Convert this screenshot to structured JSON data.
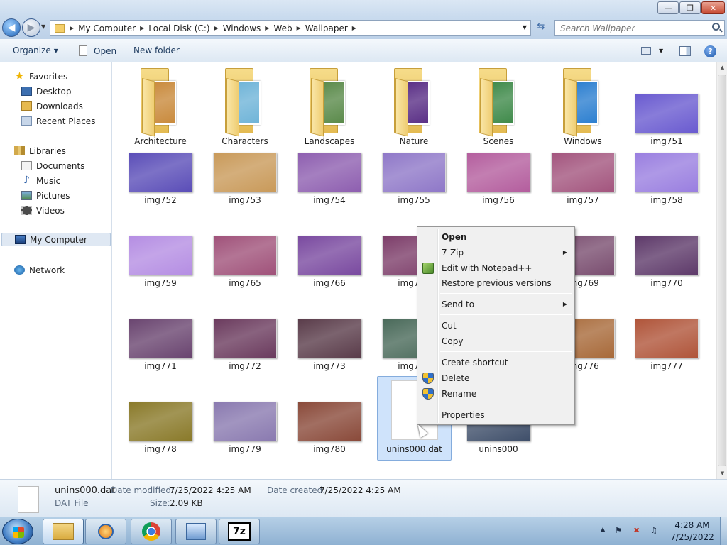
{
  "window": {
    "minimize_glyph": "—",
    "maximize_glyph": "❐",
    "close_glyph": "✕"
  },
  "nav": {
    "back_icon": "back-arrow-icon",
    "forward_icon": "forward-arrow-icon",
    "address_crumbs": [
      "My Computer",
      "Local Disk (C:)",
      "Windows",
      "Web",
      "Wallpaper"
    ],
    "search_placeholder": "Search Wallpaper"
  },
  "toolbar": {
    "organize_label": "Organize",
    "open_label": "Open",
    "new_folder_label": "New folder",
    "help_glyph": "?"
  },
  "sidebar": {
    "favorites": {
      "label": "Favorites",
      "items": [
        {
          "label": "Desktop"
        },
        {
          "label": "Downloads"
        },
        {
          "label": "Recent Places"
        }
      ]
    },
    "libraries": {
      "label": "Libraries",
      "items": [
        {
          "label": "Documents"
        },
        {
          "label": "Music"
        },
        {
          "label": "Pictures"
        },
        {
          "label": "Videos"
        }
      ]
    },
    "computer": {
      "label": "My Computer"
    },
    "network": {
      "label": "Network"
    }
  },
  "files": {
    "folders": [
      {
        "name": "Architecture",
        "color": "#c98a3c"
      },
      {
        "name": "Characters",
        "color": "#6fb4d8"
      },
      {
        "name": "Landscapes",
        "color": "#5a8a4a"
      },
      {
        "name": "Nature",
        "color": "#5a2f86"
      },
      {
        "name": "Scenes",
        "color": "#3f8a4a"
      },
      {
        "name": "Windows",
        "color": "#2c7fd0"
      }
    ],
    "images": [
      {
        "name": "img751",
        "color": "#6a5bd0"
      },
      {
        "name": "img752",
        "color": "#5b4eb8"
      },
      {
        "name": "img753",
        "color": "#c99a5a"
      },
      {
        "name": "img754",
        "color": "#8e5fb0"
      },
      {
        "name": "img755",
        "color": "#8f78c8"
      },
      {
        "name": "img756",
        "color": "#b45e9e"
      },
      {
        "name": "img757",
        "color": "#a3557e"
      },
      {
        "name": "img758",
        "color": "#9a7fe0"
      },
      {
        "name": "img759",
        "color": "#b58ee3"
      },
      {
        "name": "img765",
        "color": "#a0527a"
      },
      {
        "name": "img766",
        "color": "#7a4aa0"
      },
      {
        "name": "img767",
        "color": "#7d3e6a"
      },
      {
        "name": "img769",
        "color": "#7a4e70"
      },
      {
        "name": "img770",
        "color": "#5e3a6a"
      },
      {
        "name": "img771",
        "color": "#6a4570"
      },
      {
        "name": "img772",
        "color": "#6b3b5e"
      },
      {
        "name": "img773",
        "color": "#5a3c4a"
      },
      {
        "name": "img774",
        "color": "#4a6a5a"
      },
      {
        "name": "img776",
        "color": "#a86a3a"
      },
      {
        "name": "img777",
        "color": "#b0553a"
      },
      {
        "name": "img778",
        "color": "#8a7a2a"
      },
      {
        "name": "img779",
        "color": "#8a7ab0"
      },
      {
        "name": "img780",
        "color": "#8a4a3a"
      }
    ],
    "unins_dat": {
      "name": "unins000.dat"
    },
    "unins_exe": {
      "name": "unins000",
      "color": "#3f4f6a"
    }
  },
  "details": {
    "file_name": "unins000.dat",
    "file_type": "DAT File",
    "date_modified_label": "Date modified:",
    "date_modified": "7/25/2022 4:25 AM",
    "size_label": "Size:",
    "size": "2.09 KB",
    "date_created_label": "Date created:",
    "date_created": "7/25/2022 4:25 AM"
  },
  "context_menu": {
    "open": "Open",
    "seven_zip": "7-Zip",
    "edit_npp": "Edit with Notepad++",
    "restore": "Restore previous versions",
    "send_to": "Send to",
    "cut": "Cut",
    "copy": "Copy",
    "create_shortcut": "Create shortcut",
    "delete": "Delete",
    "rename": "Rename",
    "properties": "Properties"
  },
  "taskbar": {
    "seven_zip_label": "7z",
    "clock_time": "4:28 AM",
    "clock_date": "7/25/2022"
  }
}
